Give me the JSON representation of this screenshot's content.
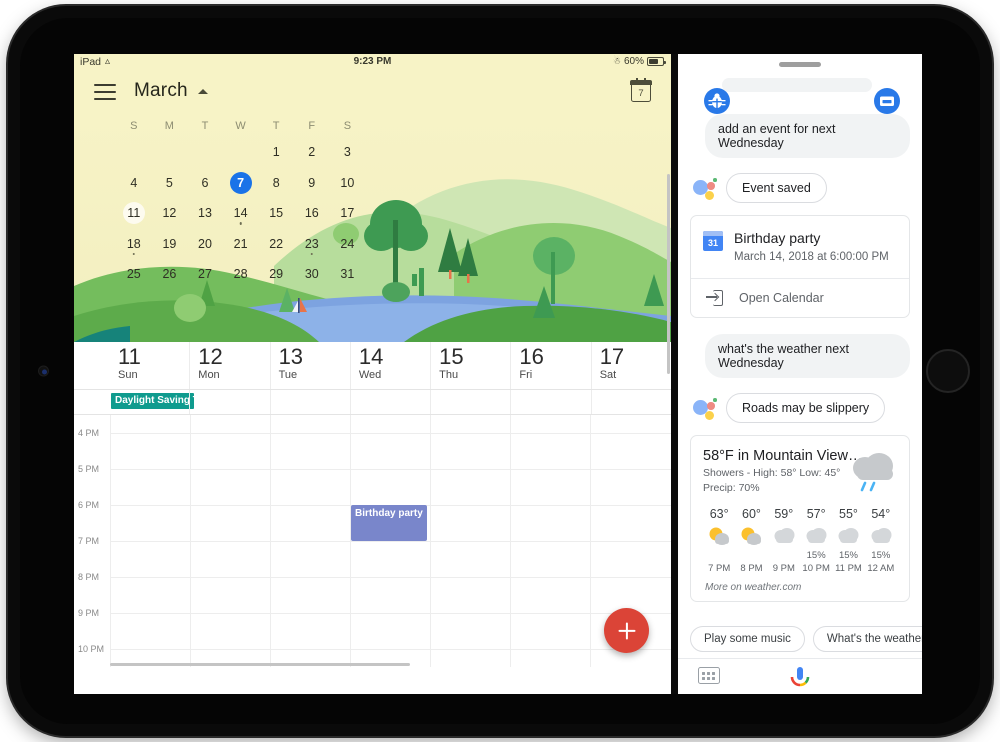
{
  "device": {
    "name": "iPad"
  },
  "status_bar": {
    "device_label": "iPad",
    "wifi_icon": "wifi-icon",
    "time": "9:23 PM",
    "bluetooth_icon": "bluetooth-icon",
    "battery_percent": "60%",
    "battery_icon": "battery-icon"
  },
  "calendar": {
    "menu_icon": "hamburger-menu-icon",
    "month_title": "March",
    "month_caret_icon": "chevron-up-icon",
    "today_icon": "calendar-today-icon",
    "today_number": "7",
    "dow_labels": [
      "S",
      "M",
      "T",
      "W",
      "T",
      "F",
      "S"
    ],
    "mini_month_weeks": [
      [
        null,
        null,
        null,
        null,
        "1",
        "2",
        "3"
      ],
      [
        "4",
        "5",
        "6",
        "7",
        "8",
        "9",
        "10"
      ],
      [
        "11",
        "12",
        "13",
        "14",
        "15",
        "16",
        "17"
      ],
      [
        "18",
        "19",
        "20",
        "21",
        "22",
        "23",
        "24"
      ],
      [
        "25",
        "26",
        "27",
        "28",
        "29",
        "30",
        "31"
      ]
    ],
    "selected_date": "7",
    "highlighted_date": "11",
    "dotted_dates": [
      "14",
      "18",
      "23"
    ],
    "week_days": [
      {
        "num": "11",
        "name": "Sun"
      },
      {
        "num": "12",
        "name": "Mon"
      },
      {
        "num": "13",
        "name": "Tue"
      },
      {
        "num": "14",
        "name": "Wed"
      },
      {
        "num": "15",
        "name": "Thu"
      },
      {
        "num": "16",
        "name": "Fri"
      },
      {
        "num": "17",
        "name": "Sat"
      }
    ],
    "allday_event": {
      "title": "Daylight Saving T",
      "color": "#0f9b8e"
    },
    "hour_labels": [
      "4 PM",
      "5 PM",
      "6 PM",
      "7 PM",
      "8 PM",
      "9 PM",
      "10 PM"
    ],
    "timed_event": {
      "title": "Birthday party",
      "color": "#7986cb",
      "day": "14",
      "start": "6 PM",
      "end": "7 PM"
    },
    "fab_icon": "add-plus-icon",
    "fab_color": "#db4437"
  },
  "assistant": {
    "drag_handle_icon": "drag-handle-icon",
    "bug_icon": "bug-report-icon",
    "feedback_icon": "feedback-message-icon",
    "logo_icon": "google-assistant-logo-icon",
    "messages": [
      {
        "type": "user",
        "text": "add an event for next Wednesday"
      },
      {
        "type": "assistant",
        "text": "Event saved"
      },
      {
        "type": "user",
        "text": "what's the weather next Wednesday"
      },
      {
        "type": "assistant",
        "text": "Roads may be slippery"
      }
    ],
    "user_query_1": "add an event for next Wednesday",
    "assistant_reply_1": "Event saved",
    "user_query_2": "what's the weather next Wednesday",
    "assistant_reply_2": "Roads may be slippery",
    "event_card": {
      "icon": "google-calendar-icon",
      "icon_number": "31",
      "title": "Birthday party",
      "subtitle": "March 14, 2018 at 6:00:00 PM",
      "action_icon": "open-in-external-icon",
      "action_label": "Open Calendar"
    },
    "weather_card": {
      "headline": "58°F in Mountain View…",
      "condition": "Showers - High: 58° Low: 45°",
      "precip": "Precip: 70%",
      "main_icon": "rain-cloud-icon",
      "hourly": [
        {
          "temp": "63°",
          "icon": "sun-behind-cloud-icon",
          "precip": "",
          "hour": "7 PM"
        },
        {
          "temp": "60°",
          "icon": "sun-behind-cloud-icon",
          "precip": "",
          "hour": "8 PM"
        },
        {
          "temp": "59°",
          "icon": "cloud-icon",
          "precip": "",
          "hour": "9 PM"
        },
        {
          "temp": "57°",
          "icon": "cloud-icon",
          "precip": "15%",
          "hour": "10 PM"
        },
        {
          "temp": "55°",
          "icon": "cloud-icon",
          "precip": "15%",
          "hour": "11 PM"
        },
        {
          "temp": "54°",
          "icon": "cloud-icon",
          "precip": "15%",
          "hour": "12 AM"
        }
      ],
      "source": "More on weather.com"
    },
    "suggestions": [
      "Play some music",
      "What's the weather tomorrow"
    ],
    "keyboard_icon": "keyboard-icon",
    "mic_icon": "microphone-icon"
  }
}
